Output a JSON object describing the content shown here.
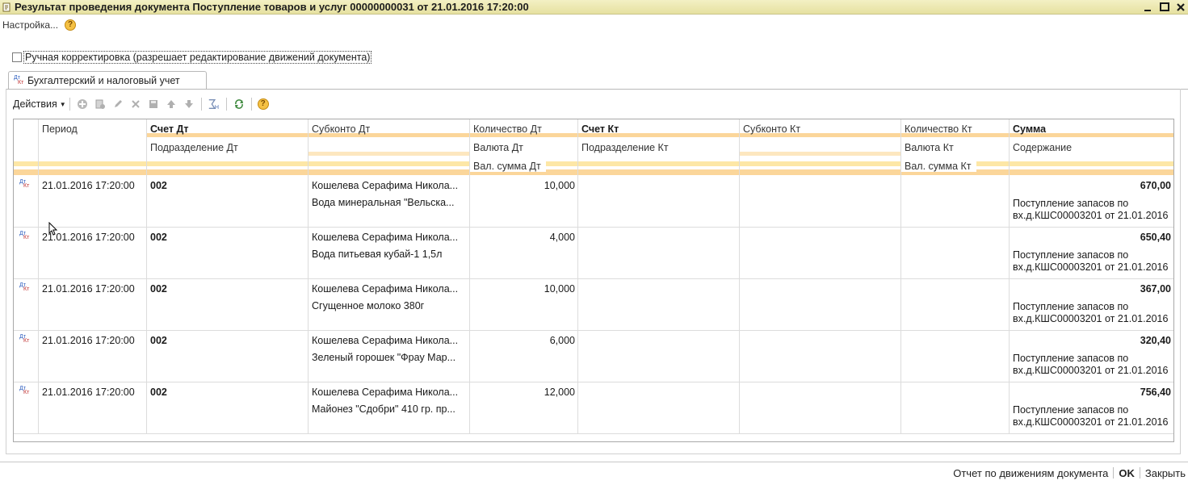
{
  "window": {
    "title": "Результат проведения документа Поступление товаров и услуг 00000000031 от 21.01.2016 17:20:00"
  },
  "menu": {
    "settings_label": "Настройка...",
    "help_label": "?"
  },
  "manual_adjust": {
    "label": "Ручная корректировка (разрешает редактирование движений документа)",
    "checked": false
  },
  "tab": {
    "icon_top": "Дт",
    "icon_bottom": "Кт",
    "label": "Бухгалтерский и налоговый учет"
  },
  "toolbar": {
    "actions_label": "Действия",
    "help_label": "?"
  },
  "table": {
    "headers": {
      "period": "Период",
      "account_dt": "Счет Дт",
      "subconto_dt": "Субконто Дт",
      "qty_dt": "Количество Дт",
      "account_kt": "Счет Кт",
      "subconto_kt": "Субконто Кт",
      "qty_kt": "Количество Кт",
      "sum": "Сумма",
      "dept_dt": "Подразделение Дт",
      "currency_dt": "Валюта Дт",
      "dept_kt": "Подразделение Кт",
      "currency_kt": "Валюта Кт",
      "content": "Содержание",
      "cur_sum_dt": "Вал. сумма Дт",
      "cur_sum_kt": "Вал. сумма Кт"
    },
    "rows": [
      {
        "period": "21.01.2016 17:20:00",
        "account_dt": "002",
        "subconto_dt_1": "Кошелева Серафима Никола...",
        "subconto_dt_2": "Вода минеральная \"Вельска...",
        "qty_dt": "10,000",
        "sum": "670,00",
        "content_1": "Поступление запасов по",
        "content_2": "вх.д.КШС00003201 от 21.01.2016"
      },
      {
        "period": "21.01.2016 17:20:00",
        "account_dt": "002",
        "subconto_dt_1": "Кошелева Серафима Никола...",
        "subconto_dt_2": "Вода питьевая кубай-1 1,5л",
        "qty_dt": "4,000",
        "sum": "650,40",
        "content_1": "Поступление запасов по",
        "content_2": "вх.д.КШС00003201 от 21.01.2016"
      },
      {
        "period": "21.01.2016 17:20:00",
        "account_dt": "002",
        "subconto_dt_1": "Кошелева Серафима Никола...",
        "subconto_dt_2": "Сгущенное молоко 380г",
        "qty_dt": "10,000",
        "sum": "367,00",
        "content_1": "Поступление запасов по",
        "content_2": "вх.д.КШС00003201 от 21.01.2016"
      },
      {
        "period": "21.01.2016 17:20:00",
        "account_dt": "002",
        "subconto_dt_1": "Кошелева Серафима Никола...",
        "subconto_dt_2": "Зеленый горошек \"Фрау Мар...",
        "qty_dt": "6,000",
        "sum": "320,40",
        "content_1": "Поступление запасов по",
        "content_2": "вх.д.КШС00003201 от 21.01.2016"
      },
      {
        "period": "21.01.2016 17:20:00",
        "account_dt": "002",
        "subconto_dt_1": "Кошелева Серафима Никола...",
        "subconto_dt_2": "Майонез \"Сдобри\" 410 гр. пр...",
        "qty_dt": "12,000",
        "sum": "756,40",
        "content_1": "Поступление запасов по",
        "content_2": "вх.д.КШС00003201 от 21.01.2016"
      }
    ]
  },
  "footer": {
    "report_label": "Отчет по движениям документа",
    "ok_label": "OK",
    "close_label": "Закрыть"
  },
  "colors": {
    "title_bar": "#e6e1a0",
    "header_stripe": "#fbd69a",
    "help_icon": "#f5c144"
  },
  "icons": [
    "document-icon",
    "minimize-icon",
    "maximize-icon",
    "close-icon",
    "help-icon",
    "dt-kt-icon",
    "add-icon",
    "copy-icon",
    "edit-icon",
    "delete-icon",
    "save-icon",
    "move-up-icon",
    "move-down-icon",
    "sum-icon",
    "refresh-icon"
  ]
}
